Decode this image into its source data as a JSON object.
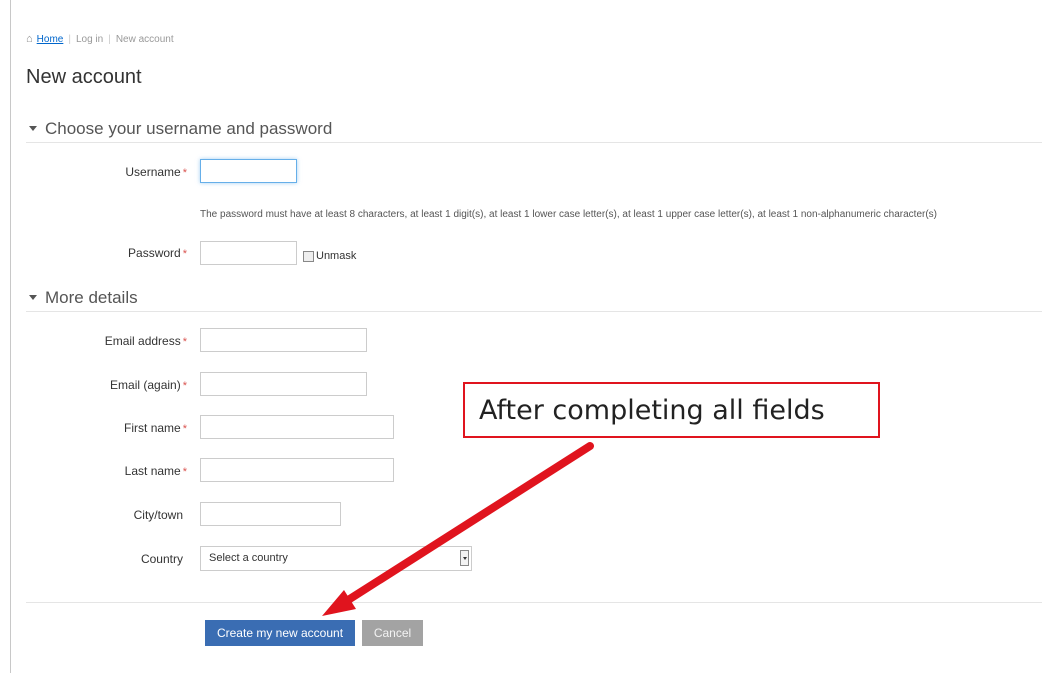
{
  "breadcrumb": {
    "home": "Home",
    "login": "Log in",
    "current": "New account"
  },
  "page_title": "New account",
  "sections": {
    "credentials": "Choose your username and password",
    "details": "More details"
  },
  "fields": {
    "username": {
      "label": "Username",
      "value": ""
    },
    "password_help": "The password must have at least 8 characters, at least 1 digit(s), at least 1 lower case letter(s), at least 1 upper case letter(s), at least 1 non-alphanumeric character(s)",
    "password": {
      "label": "Password",
      "value": ""
    },
    "unmask": "Unmask",
    "email": {
      "label": "Email address",
      "value": ""
    },
    "email_again": {
      "label": "Email (again)",
      "value": ""
    },
    "first_name": {
      "label": "First name",
      "value": ""
    },
    "last_name": {
      "label": "Last name",
      "value": ""
    },
    "city": {
      "label": "City/town",
      "value": ""
    },
    "country": {
      "label": "Country",
      "selected": "Select a country"
    }
  },
  "required_marker": "*",
  "buttons": {
    "create": "Create my new account",
    "cancel": "Cancel"
  },
  "annotation": {
    "text": "After completing all fields",
    "color": "#e0141e"
  },
  "colors": {
    "primary_button": "#3a6db3",
    "required": "#d9534f",
    "link": "#0066cc"
  }
}
